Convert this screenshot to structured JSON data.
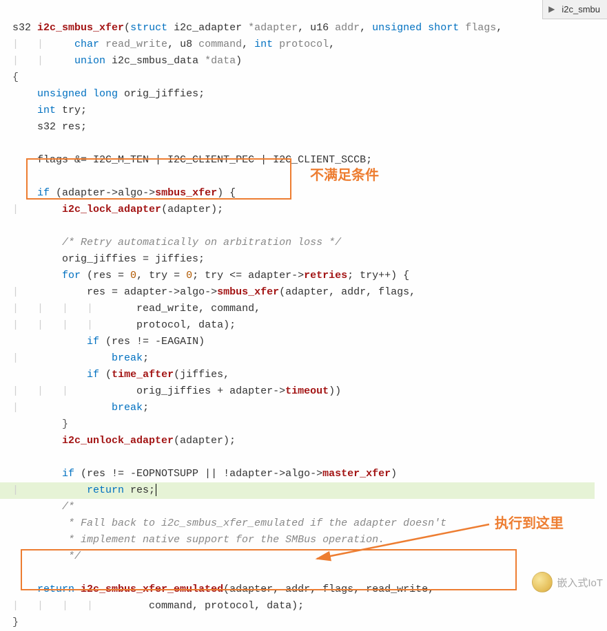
{
  "tab": {
    "label": "i2c_smbu"
  },
  "code": {
    "l1_t1": "s32 ",
    "l1_fn": "i2c_smbus_xfer",
    "l1_t2": "(",
    "l1_kw1": "struct",
    "l1_t3": " i2c_adapter ",
    "l1_p1": "*adapter",
    "l1_t4": ", u16 ",
    "l1_p2": "addr",
    "l1_t5": ", ",
    "l1_kw2": "unsigned short",
    "l1_t6": " ",
    "l1_p3": "flags",
    "l1_t7": ",",
    "l2_t1": "char",
    "l2_p1": " read_write",
    "l2_t2": ", u8 ",
    "l2_p2": "command",
    "l2_t3": ", ",
    "l2_kw": "int",
    "l2_p3": " protocol",
    "l2_t4": ",",
    "l3_kw": "union",
    "l3_t1": " i2c_smbus_data ",
    "l3_p": "*data",
    "l3_t2": ")",
    "l4": "{",
    "l5_kw": "unsigned long",
    "l5_t": " orig_jiffies;",
    "l6_kw": "int",
    "l6_t": " try;",
    "l7_t": "s32 res;",
    "l8_t1": "flags &= I2C_M_TEN | I2C_CLIENT_PEC | I2C_CLIENT_SCCB;",
    "l9_kw": "if",
    "l9_t1": " (adapter->",
    "l9_f1": "algo",
    "l9_t2": "->",
    "l9_f2": "smbus_xfer",
    "l9_t3": ") {",
    "l10_fn": "i2c_lock_adapter",
    "l10_t": "(adapter);",
    "l11_c": "/* Retry automatically on arbitration loss */",
    "l12_t": "orig_jiffies = jiffies;",
    "l13_kw": "for",
    "l13_t1": " (res = ",
    "l13_n1": "0",
    "l13_t2": ", try = ",
    "l13_n2": "0",
    "l13_t3": "; try <= adapter->",
    "l13_f": "retries",
    "l13_t4": "; try++) {",
    "l14_t1": "res = adapter->",
    "l14_f1": "algo",
    "l14_t2": "->",
    "l14_f2": "smbus_xfer",
    "l14_t3": "(adapter, addr, flags,",
    "l15_t": "read_write, command,",
    "l16_t": "protocol, data);",
    "l17_kw": "if",
    "l17_t": " (res != -EAGAIN)",
    "l18_kw": "break",
    "l18_t": ";",
    "l19_kw": "if",
    "l19_t1": " (",
    "l19_fn": "time_after",
    "l19_t2": "(jiffies,",
    "l20_t1": "orig_jiffies + adapter->",
    "l20_f": "timeout",
    "l20_t2": "))",
    "l21_kw": "break",
    "l21_t": ";",
    "l22": "}",
    "l23_fn": "i2c_unlock_adapter",
    "l23_t": "(adapter);",
    "l24_kw": "if",
    "l24_t1": " (res != -EOPNOTSUPP || !adapter->",
    "l24_f1": "algo",
    "l24_t2": "->",
    "l24_f2": "master_xfer",
    "l24_t3": ")",
    "l25_kw": "return",
    "l25_t": " res;",
    "l26_c1": "/*",
    "l26_c2": " * Fall back to i2c_smbus_xfer_emulated if the adapter doesn't",
    "l26_c3": " * implement native support for the SMBus operation.",
    "l26_c4": " */",
    "l27_kw": "return",
    "l27_fn": " i2c_smbus_xfer_emulated",
    "l27_t1": "(adapter, addr, flags, read_write,",
    "l28_t": "command, protocol, data);",
    "l29": "}"
  },
  "annot": {
    "a1": "不满足条件",
    "a2": "执行到这里"
  },
  "watermark": "嵌入式IoT"
}
